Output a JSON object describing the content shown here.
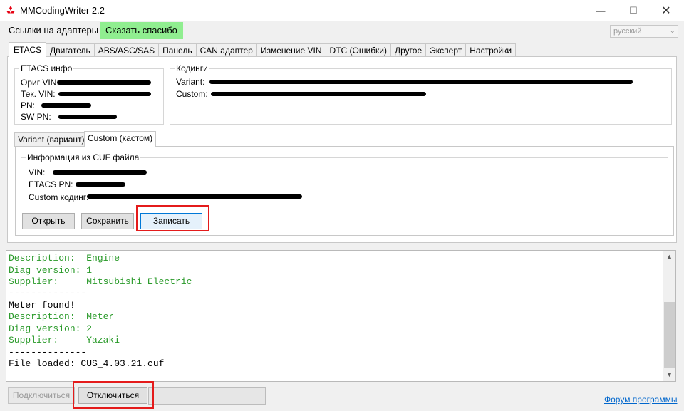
{
  "app": {
    "title": "MMCodingWriter 2.2"
  },
  "menu": {
    "adapters_link": "Ссылки на адаптеры",
    "thanks": "Сказать спасибо",
    "language": "русский"
  },
  "tabs": [
    {
      "label": "ETACS",
      "active": true
    },
    {
      "label": "Двигатель"
    },
    {
      "label": "ABS/ASC/SAS"
    },
    {
      "label": "Панель"
    },
    {
      "label": "CAN адаптер"
    },
    {
      "label": "Изменение VIN"
    },
    {
      "label": "DTC (Ошибки)"
    },
    {
      "label": "Другое"
    },
    {
      "label": "Эксперт"
    },
    {
      "label": "Настройки"
    }
  ],
  "etacs_info": {
    "legend": "ETACS инфо",
    "labels": {
      "orig_vin": "Ориг VIN:",
      "cur_vin": "Тек. VIN:",
      "pn": "PN:",
      "sw_pn": "SW PN:"
    }
  },
  "codings": {
    "legend": "Кодинги",
    "labels": {
      "variant": "Variant:",
      "custom": "Custom:"
    }
  },
  "subtabs": [
    {
      "label": "Variant (вариант)"
    },
    {
      "label": "Custom (кастом)",
      "active": true
    }
  ],
  "cuf_info": {
    "legend": "Информация из CUF файла",
    "labels": {
      "vin": "VIN:",
      "etacs_pn": "ETACS PN:",
      "custom_coding": "Custom кодинг:"
    }
  },
  "buttons": {
    "open": "Открыть",
    "save": "Сохранить",
    "write": "Записать"
  },
  "log": [
    {
      "text": "Description:  Engine",
      "color": "green"
    },
    {
      "text": "Diag version: 1",
      "color": "green"
    },
    {
      "text": "Supplier:     Mitsubishi Electric",
      "color": "green"
    },
    {
      "text": "--------------",
      "color": "black"
    },
    {
      "text": "Meter found!",
      "color": "black"
    },
    {
      "text": "Description:  Meter",
      "color": "green"
    },
    {
      "text": "Diag version: 2",
      "color": "green"
    },
    {
      "text": "Supplier:     Yazaki",
      "color": "green"
    },
    {
      "text": "--------------",
      "color": "black"
    },
    {
      "text": "File loaded: CUS_4.03.21.cuf",
      "color": "black"
    }
  ],
  "bottom": {
    "connect": "Подключиться",
    "disconnect": "Отключиться",
    "forum": "Форум программы"
  },
  "colors": {
    "highlight": "#e41b1b",
    "thanks_bg": "#90ee90",
    "log_green": "#2a9a2a",
    "link": "#0066cc"
  }
}
